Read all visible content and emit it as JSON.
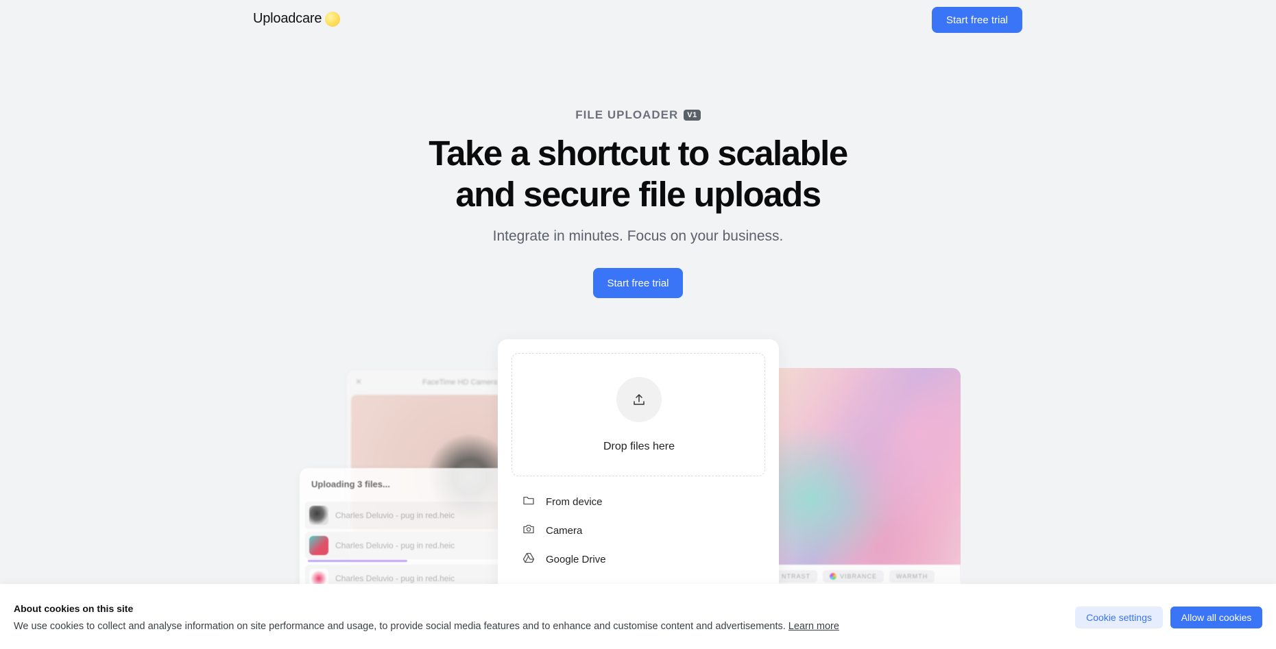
{
  "header": {
    "logo_text": "Uploadcare",
    "cta_label": "Start free trial"
  },
  "hero": {
    "eyebrow": "FILE UPLOADER",
    "eyebrow_badge": "V1",
    "headline_line1": "Take a shortcut to scalable",
    "headline_line2": "and secure file uploads",
    "subhead": "Integrate in minutes. Focus on your business.",
    "cta_label": "Start free trial"
  },
  "camera_card": {
    "title": "FaceTime HD Camera (Bu",
    "close_icon": "close-icon"
  },
  "uploading_card": {
    "title": "Uploading 3 files...",
    "files": [
      {
        "name": "Charles Deluvio - pug in red.heic"
      },
      {
        "name": "Charles Deluvio - pug in red.heic"
      },
      {
        "name": "Charles Deluvio - pug in red.heic"
      }
    ],
    "progress": 0.5
  },
  "editor_card": {
    "adjustments": [
      "NTRAST",
      "VIBRANCE",
      "WARMTH"
    ]
  },
  "uploader": {
    "drop_label": "Drop files here",
    "sources": [
      {
        "label": "From device",
        "icon": "folder-icon"
      },
      {
        "label": "Camera",
        "icon": "camera-icon"
      },
      {
        "label": "Google Drive",
        "icon": "google-drive-icon"
      }
    ]
  },
  "cookie_banner": {
    "title": "About cookies on this site",
    "text": "We use cookies to collect and analyse information on site performance and usage, to provide social media features and to enhance and customise content and advertisements.",
    "learn_more": "Learn more",
    "settings_label": "Cookie settings",
    "allow_label": "Allow all cookies"
  },
  "colors": {
    "accent": "#3a74f7",
    "background": "#f2f3f5",
    "logo_dot": "#ffe36b"
  }
}
